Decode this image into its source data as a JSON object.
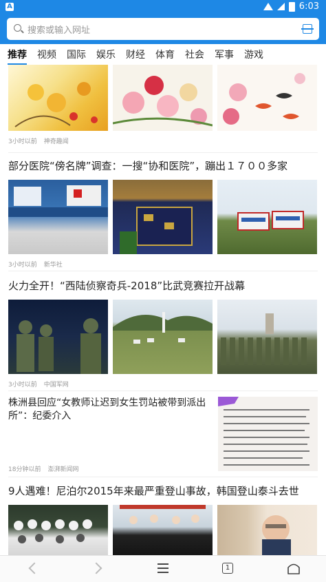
{
  "status": {
    "time": "6:03"
  },
  "search": {
    "placeholder": "搜索或输入网址"
  },
  "tabs": [
    "推荐",
    "视频",
    "国际",
    "娱乐",
    "财经",
    "体育",
    "社会",
    "军事",
    "游戏"
  ],
  "feed": {
    "item0": {
      "time": "3小时以前",
      "source": "神奇趣闻"
    },
    "item1": {
      "title": "部分医院“傍名牌”调查：一搜“协和医院”，蹦出１７００多家",
      "time": "3小时以前",
      "source": "新华社"
    },
    "item2": {
      "title": "火力全开！“西陆侦察奇兵-2018”比武竞赛拉开战幕",
      "time": "3小时以前",
      "source": "中国军网"
    },
    "item3": {
      "title": "株洲县回应“女教师让迟到女生罚站被带到派出所”：纪委介入",
      "time": "18分钟以前",
      "source": "澎湃新闻网"
    },
    "item4": {
      "title": "9人遇难！尼泊尔2015年来最严重登山事故，韩国登山泰斗去世"
    }
  },
  "navbar": {
    "tab_count": "1"
  }
}
